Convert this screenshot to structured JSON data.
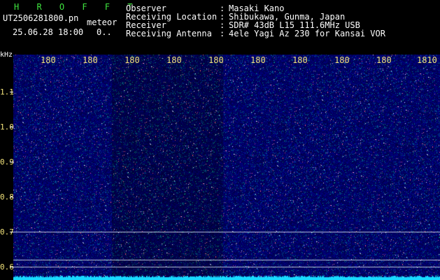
{
  "header": {
    "app_title": "H R O F F T",
    "filename": "UT2506281800.pn",
    "tag": "meteor",
    "datetime": "25.06.28 18:00",
    "counter": "0..",
    "fields": [
      {
        "label": "Observer",
        "sep": ":",
        "value": "Masaki Kano"
      },
      {
        "label": "Receiving Location",
        "sep": ":",
        "value": "Shibukawa, Gunma, Japan"
      },
      {
        "label": "Receiver",
        "sep": ":",
        "value": "SDR# 43dB L15 111.6MHz USB"
      },
      {
        "label": "Receiving Antenna",
        "sep": ":",
        "value": "4ele Yagi Az 230 for Kansai VOR"
      }
    ]
  },
  "axes": {
    "y_unit": "kHz",
    "x_ticks": [
      "180",
      "180",
      "180",
      "180",
      "180",
      "180",
      "180",
      "180",
      "180",
      "1810"
    ],
    "y_ticks": [
      "1.1",
      "1.0",
      "0.9",
      "0.8",
      "0.7",
      "0.6"
    ]
  },
  "colors": {
    "background": "#000000",
    "waterfall": "#0a0a6e",
    "signal_bar": "#19d9ff",
    "title": "#3fe53f",
    "tick": "#f2e27a"
  }
}
